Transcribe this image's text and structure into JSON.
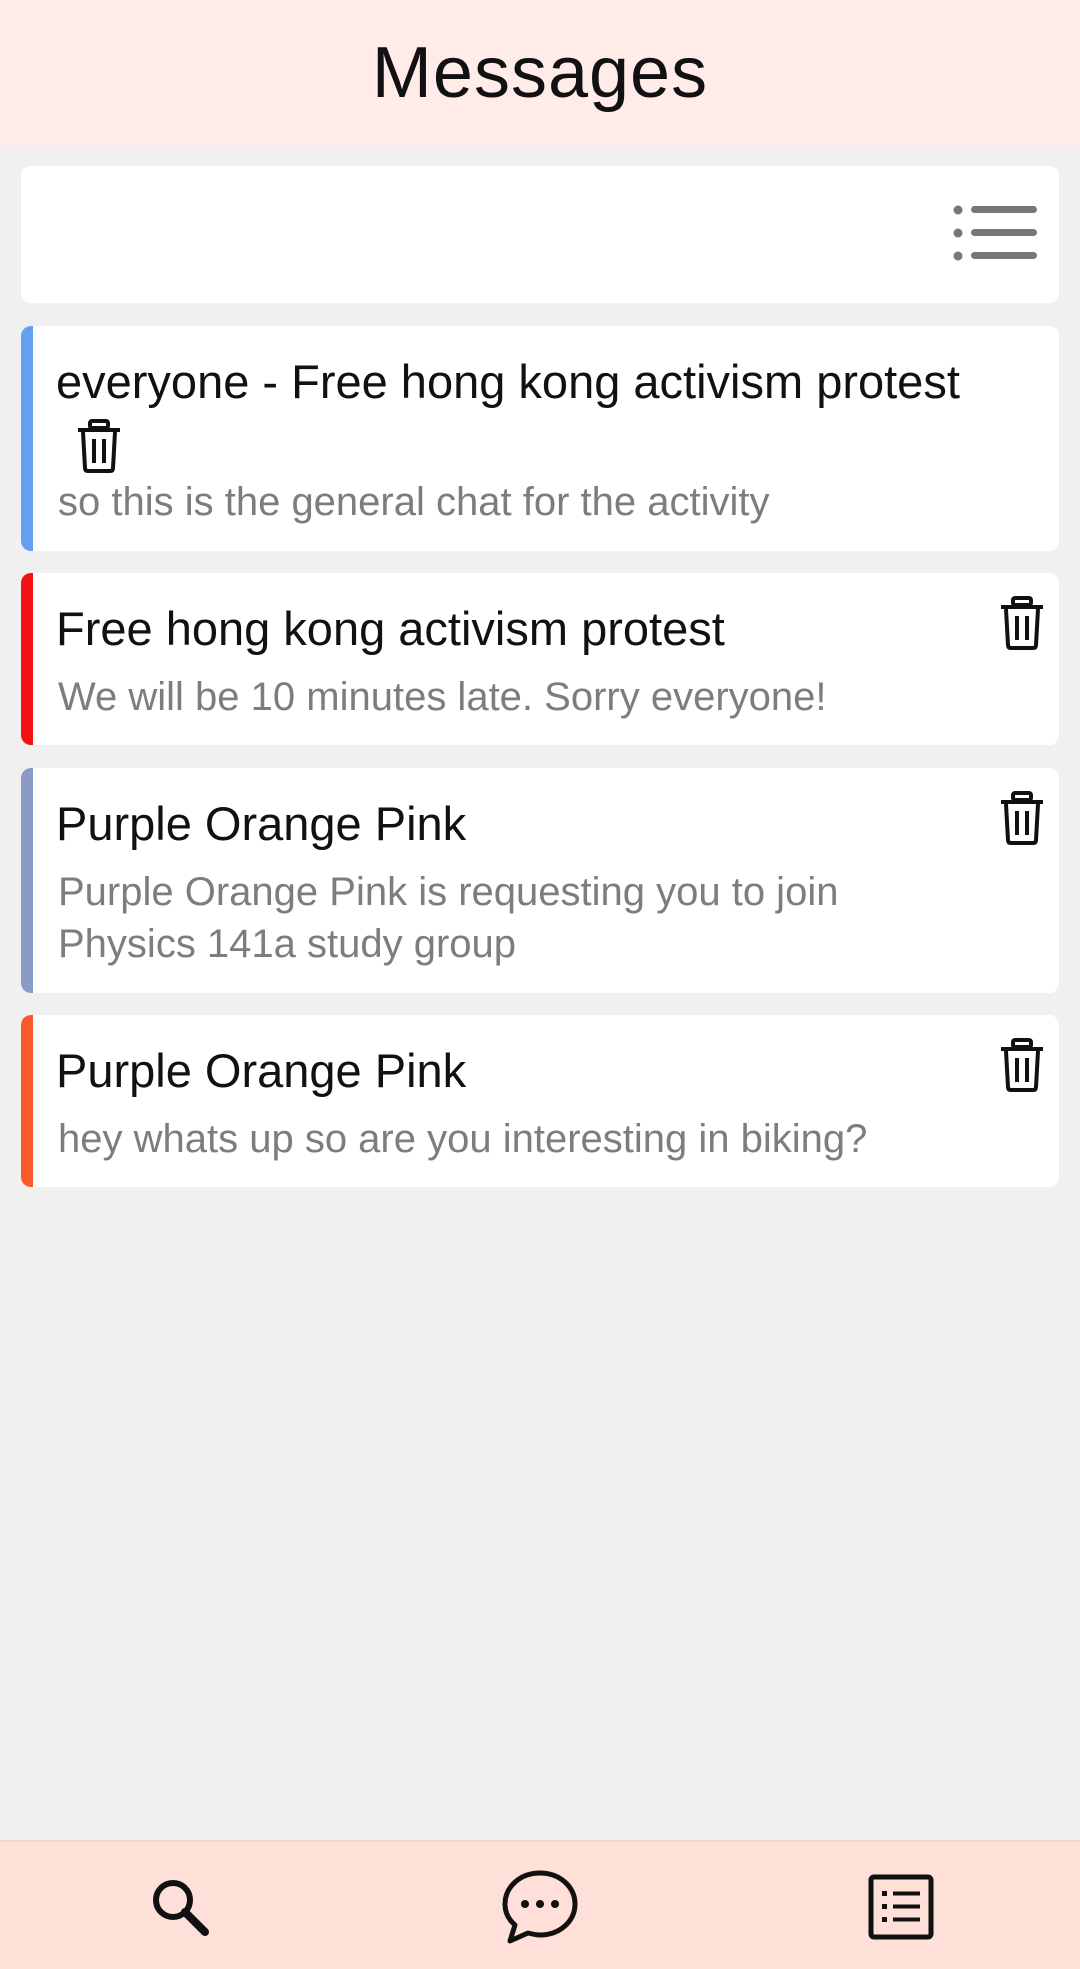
{
  "header": {
    "title": "Messages"
  },
  "filter": {
    "icon": "list-filter-icon"
  },
  "conversations": [
    {
      "title": "everyone - Free hong kong activism protest",
      "preview": "so this is the general chat for the activity",
      "accent": "#64a0f0"
    },
    {
      "title": "Free hong kong activism protest",
      "preview": "We will be 10 minutes late. Sorry everyone!",
      "accent": "#f01414"
    },
    {
      "title": "Purple Orange Pink",
      "preview": "Purple Orange Pink is requesting you to join Physics  141a study group",
      "accent": "#8c9ac8"
    },
    {
      "title": "Purple Orange Pink",
      "preview": "hey whats up so are you interesting in biking?",
      "accent": "#fa5a28"
    }
  ],
  "bottom_nav": {
    "items": [
      {
        "icon": "search-icon"
      },
      {
        "icon": "chat-bubble-icon"
      },
      {
        "icon": "list-icon"
      }
    ]
  },
  "colors": {
    "header_bg": "#ffebe8",
    "nav_bg": "#ffe0d8",
    "page_bg": "#f0f0f0"
  }
}
